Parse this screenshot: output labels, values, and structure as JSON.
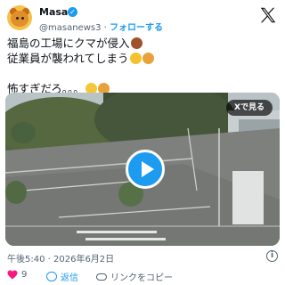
{
  "user": {
    "display_name": "Masa",
    "verified_badge": "✓",
    "handle": "@masanews3",
    "separator": "·",
    "follow_label": "フォローする",
    "avatar_icon": "bear-avatar-icon"
  },
  "tweet": {
    "lines": [
      "福島の工場にクマが侵入",
      "従業員が襲われてしまう",
      "怖すぎだろ。。。"
    ]
  },
  "media": {
    "watch_label": "Xで見る",
    "play_icon": "play-icon"
  },
  "meta": {
    "timestamp": "午後5:40 · 2026年6月2日",
    "info_icon": "i"
  },
  "actions": {
    "like_count": "9",
    "reply_label": "返信",
    "copy_link_label": "リンクをコピー"
  },
  "colors": {
    "accent": "#1d9bf0",
    "like": "#f91880",
    "text_secondary": "#536471"
  }
}
